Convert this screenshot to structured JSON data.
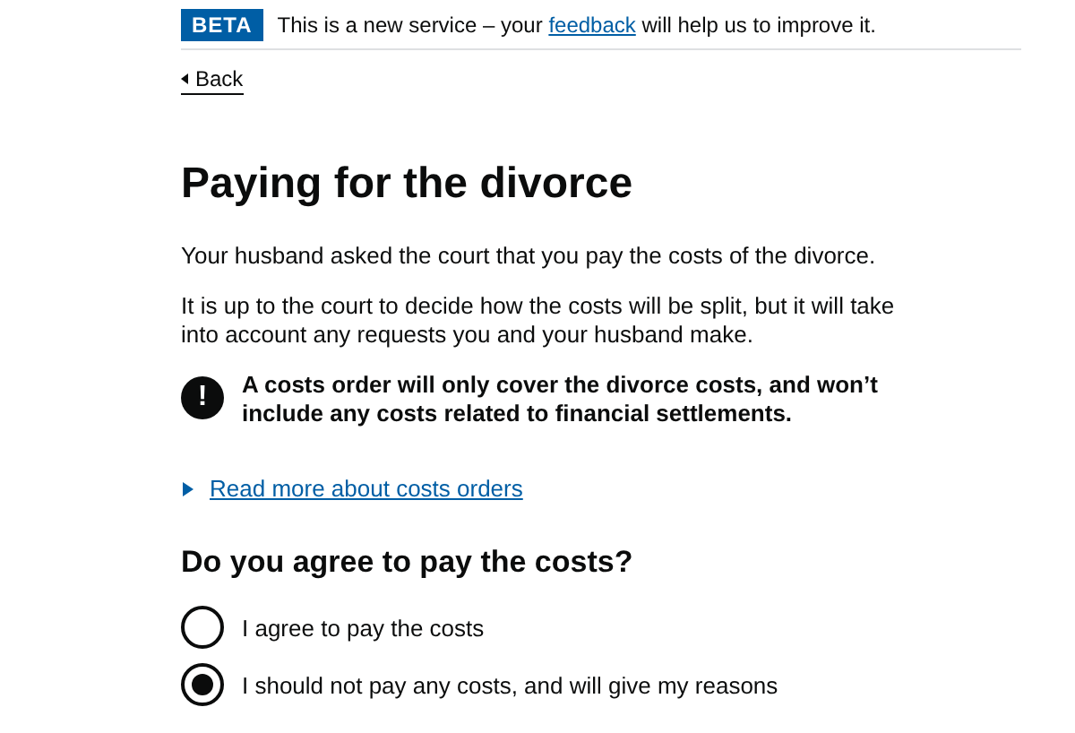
{
  "phase_banner": {
    "tag": "BETA",
    "text_before": "This is a new service – your",
    "link": "feedback",
    "text_after": "will help us to improve it."
  },
  "back_link": "Back",
  "heading": "Paying for the divorce",
  "paragraphs": [
    "Your husband asked the court that you pay the costs of the divorce.",
    "It is up to the court to decide how the costs will be split, but it will take into account any requests you and your husband make."
  ],
  "warning": {
    "icon": "!",
    "text": "A costs order will only cover the divorce costs, and won’t include any costs related to financial settlements."
  },
  "details": {
    "summary": "Read more about costs orders",
    "expanded": false
  },
  "question": "Do you agree to pay the costs?",
  "options": [
    {
      "label": "I agree to pay the costs",
      "selected": false
    },
    {
      "label": "I should not pay any costs, and will give my reasons",
      "selected": true
    }
  ]
}
